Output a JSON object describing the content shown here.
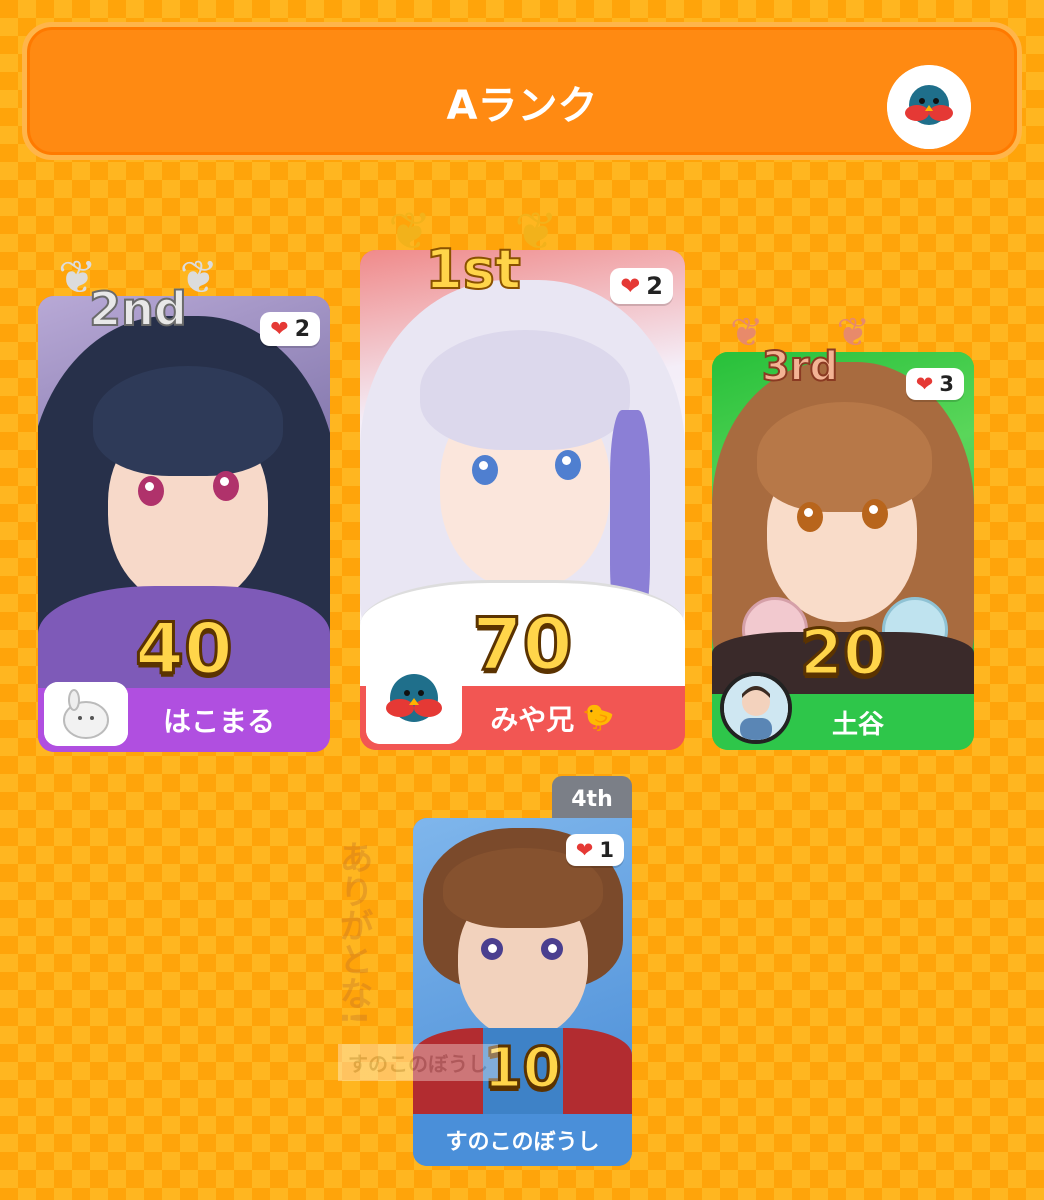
{
  "header": {
    "title": "Aランク"
  },
  "cards": [
    {
      "rank": "2nd",
      "score": "40",
      "hearts": "2",
      "name": "はこまる",
      "color": "#b04fe0"
    },
    {
      "rank": "1st",
      "score": "70",
      "hearts": "2",
      "name": "みや兄",
      "color": "#f25653"
    },
    {
      "rank": "3rd",
      "score": "20",
      "hearts": "3",
      "name": "土谷",
      "color": "#2ec64a"
    },
    {
      "rank": "4th",
      "score": "10",
      "hearts": "1",
      "name": "すのこのぼうし",
      "color": "#4a8fd9"
    }
  ],
  "watermark": {
    "text": "ありがとな!",
    "sub": "すのこのぼうし"
  },
  "icons": {
    "heart": "heart-icon",
    "chick": "chick-icon",
    "laurel": "laurel-icon",
    "bird": "bird-avatar-icon"
  }
}
